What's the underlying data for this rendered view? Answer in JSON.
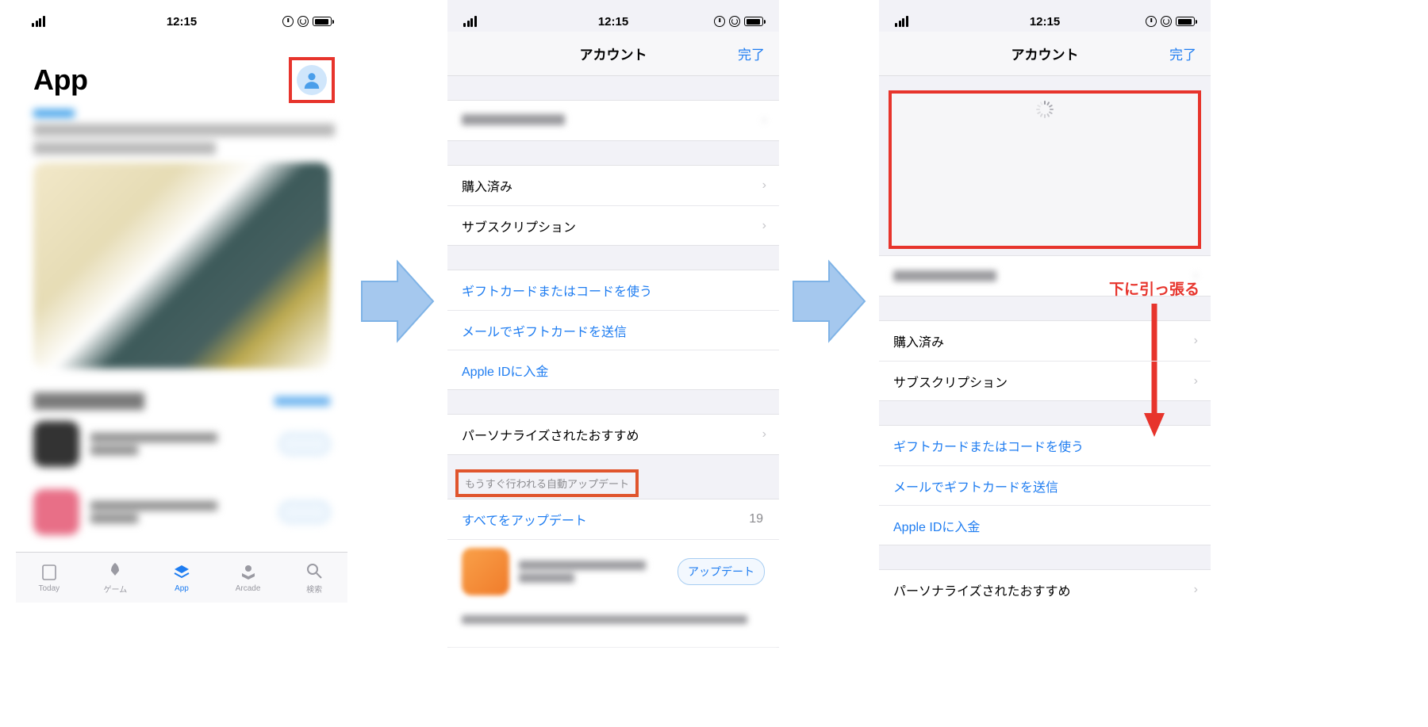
{
  "status": {
    "time": "12:15"
  },
  "phone1": {
    "title": "App",
    "tabs": {
      "today": "Today",
      "games": "ゲーム",
      "apps": "App",
      "arcade": "Arcade",
      "search": "検索"
    }
  },
  "phone2": {
    "nav_title": "アカウント",
    "done": "完了",
    "rows": {
      "purchased": "購入済み",
      "subscriptions": "サブスクリプション",
      "redeem": "ギフトカードまたはコードを使う",
      "sendgift": "メールでギフトカードを送信",
      "addfunds": "Apple IDに入金",
      "personalized": "パーソナライズされたおすすめ"
    },
    "section_upcoming": "もうすぐ行われる自動アップデート",
    "update_all": "すべてをアップデート",
    "update_count": "19",
    "update_btn": "アップデート"
  },
  "phone3": {
    "nav_title": "アカウント",
    "done": "完了",
    "pull_label": "下に引っ張る",
    "rows": {
      "purchased": "購入済み",
      "subscriptions": "サブスクリプション",
      "redeem": "ギフトカードまたはコードを使う",
      "sendgift": "メールでギフトカードを送信",
      "addfunds": "Apple IDに入金",
      "personalized": "パーソナライズされたおすすめ"
    }
  }
}
